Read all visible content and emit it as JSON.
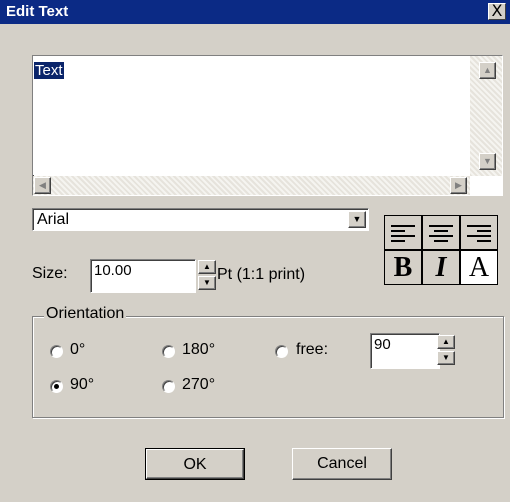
{
  "window": {
    "title": "Edit Text",
    "close_glyph": "X"
  },
  "text_area": {
    "value": "Text"
  },
  "font": {
    "selected": "Arial"
  },
  "size": {
    "label": "Size:",
    "value": "10.00",
    "unit_label": "Pt (1:1 print)"
  },
  "style_buttons": {
    "bold": "B",
    "italic": "I",
    "plain": "A"
  },
  "orientation": {
    "legend": "Orientation",
    "options": [
      {
        "label": "0°",
        "checked": false
      },
      {
        "label": "180°",
        "checked": false
      },
      {
        "label": "free:",
        "checked": false
      },
      {
        "label": "90°",
        "checked": true
      },
      {
        "label": "270°",
        "checked": false
      }
    ],
    "free_value": "90"
  },
  "buttons": {
    "ok": "OK",
    "cancel": "Cancel"
  },
  "colors": {
    "titlebar": "#0b2a85",
    "face": "#d4d0c8",
    "selection": "#0a246a"
  }
}
